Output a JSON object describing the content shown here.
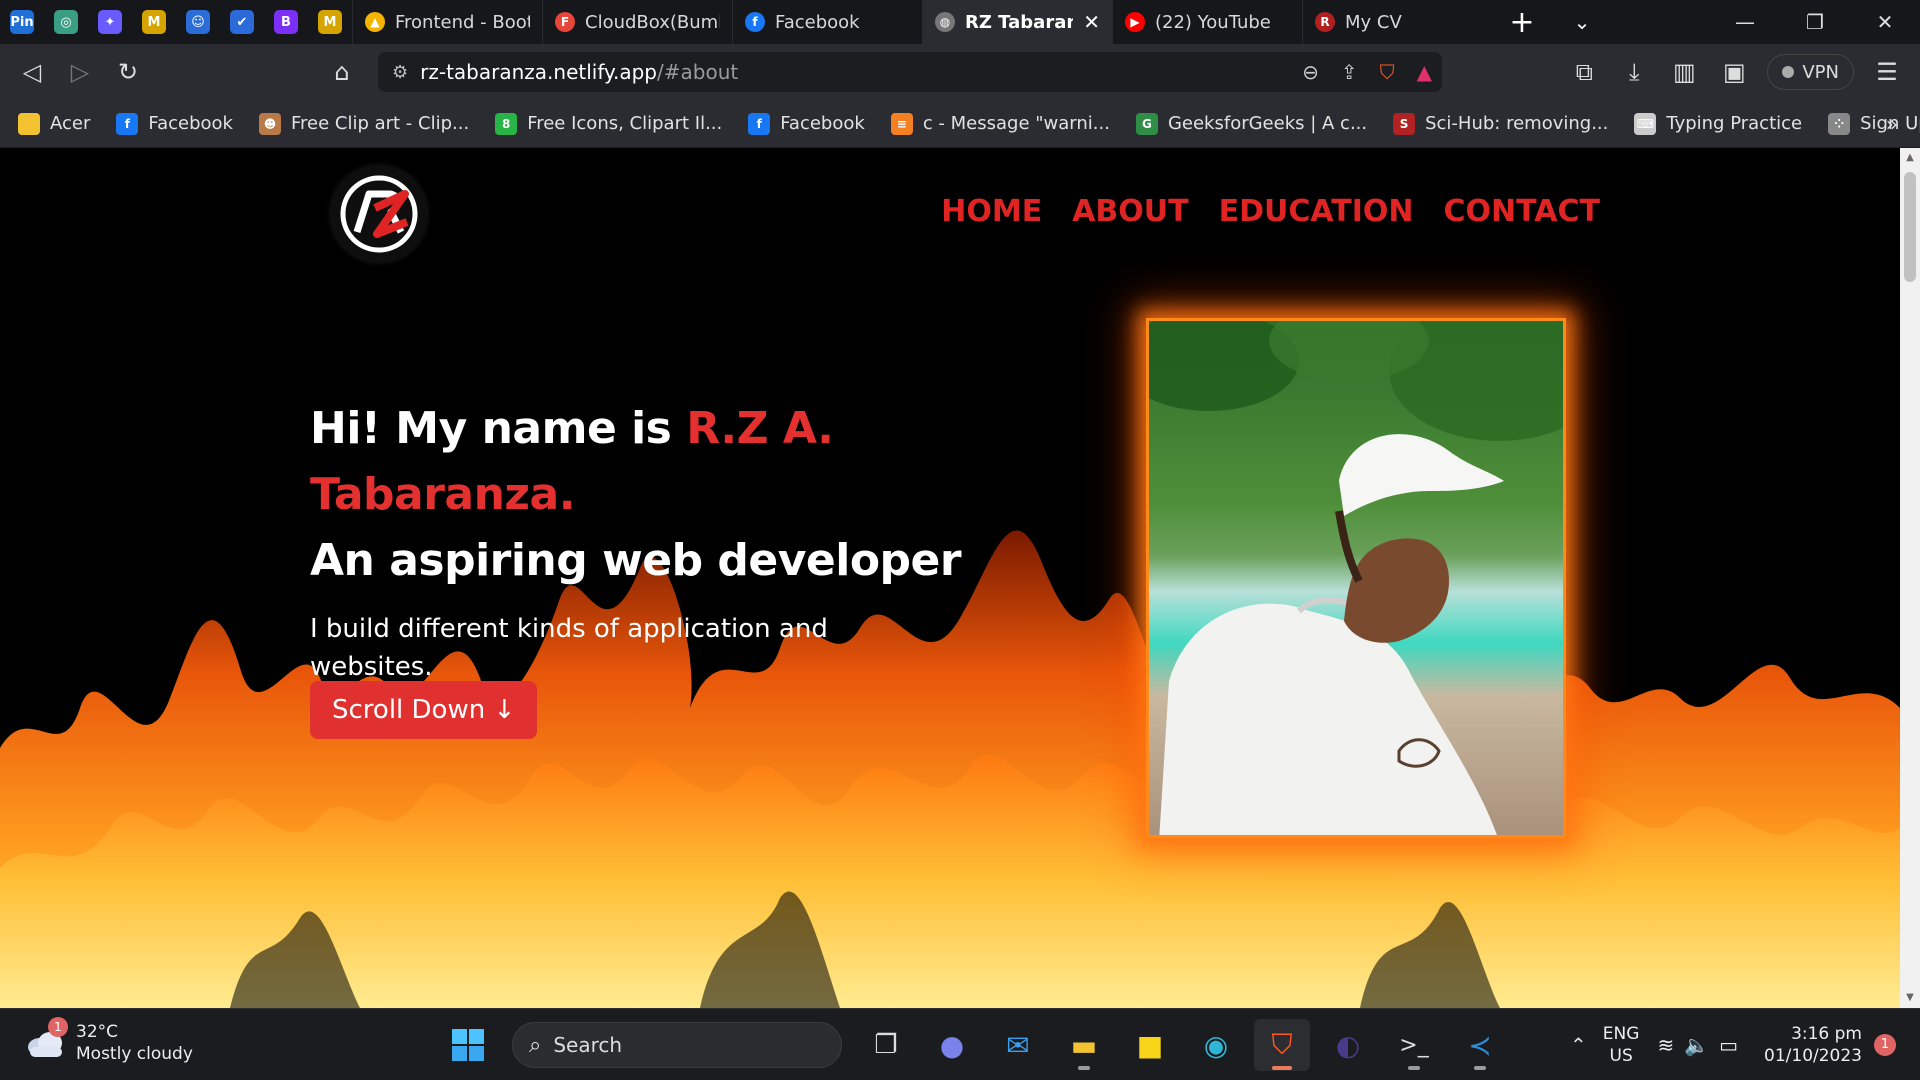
{
  "browser": {
    "pinned_tabs": [
      {
        "icon": "pinterest-icon",
        "glyph": "Pin",
        "color": "#1f6fd6"
      },
      {
        "icon": "chatgpt-icon",
        "glyph": "◎",
        "color": "#3a9e84"
      },
      {
        "icon": "sparkle-icon",
        "glyph": "✦",
        "color": "#6a5bff"
      },
      {
        "icon": "miro-icon",
        "glyph": "M",
        "color": "#d6a400"
      },
      {
        "icon": "robot-icon",
        "glyph": "☺",
        "color": "#2b6dd6"
      },
      {
        "icon": "check-icon",
        "glyph": "✔",
        "color": "#2a6bd9"
      },
      {
        "icon": "bootstrap-icon",
        "glyph": "B",
        "color": "#7b2ff7"
      },
      {
        "icon": "miro-icon",
        "glyph": "M",
        "color": "#d6a400"
      }
    ],
    "tabs": [
      {
        "title": "Frontend - Boots",
        "icon": "google-drive-icon",
        "color": "#f4b400",
        "glyph": "▲"
      },
      {
        "title": "CloudBox(Bumbu",
        "icon": "figma-icon",
        "color": "#e8463a",
        "glyph": "F"
      },
      {
        "title": "Facebook",
        "icon": "facebook-icon",
        "color": "#1877f2",
        "glyph": "f"
      },
      {
        "title": "RZ Tabaranza",
        "icon": "globe-icon",
        "color": "#777777",
        "glyph": "◍",
        "active": true
      },
      {
        "title": "(22) YouTube",
        "icon": "youtube-icon",
        "color": "#ff0000",
        "glyph": "▶"
      },
      {
        "title": "My CV",
        "icon": "rz-logo-icon",
        "color": "#b02020",
        "glyph": "R"
      }
    ],
    "address": {
      "host": "rz-tabaranza.netlify.app",
      "path": "/#about"
    },
    "vpn_label": "VPN",
    "bookmarks": [
      {
        "label": "Acer",
        "icon": "folder-icon",
        "color": "#f2c230",
        "glyph": ""
      },
      {
        "label": "Facebook",
        "icon": "facebook-icon",
        "color": "#1877f2",
        "glyph": "f"
      },
      {
        "label": "Free Clip art - Clip...",
        "icon": "clipart-icon",
        "color": "#b97a4a",
        "glyph": "☻"
      },
      {
        "label": "Free Icons, Clipart Il...",
        "icon": "icons8-icon",
        "color": "#28b446",
        "glyph": "8"
      },
      {
        "label": "Facebook",
        "icon": "facebook-icon",
        "color": "#1877f2",
        "glyph": "f"
      },
      {
        "label": "c - Message \"warni...",
        "icon": "stackoverflow-icon",
        "color": "#f48024",
        "glyph": "≡"
      },
      {
        "label": "GeeksforGeeks | A c...",
        "icon": "geeksforgeeks-icon",
        "color": "#2f8d46",
        "glyph": "G"
      },
      {
        "label": "Sci-Hub: removing...",
        "icon": "scihub-icon",
        "color": "#b22222",
        "glyph": "S"
      },
      {
        "label": "Typing Practice",
        "icon": "keyboard-icon",
        "color": "#cccccc",
        "glyph": "⌨"
      },
      {
        "label": "Sign Up",
        "icon": "dots-icon",
        "color": "#888888",
        "glyph": "⁘"
      }
    ]
  },
  "page": {
    "nav": [
      "HOME",
      "ABOUT",
      "EDUCATION",
      "CONTACT"
    ],
    "hero": {
      "greeting": "Hi! My name is ",
      "name": "R.Z A. Tabaranza.",
      "tagline": "An aspiring web developer",
      "description": "I build different kinds of application and websites.",
      "button": "Scroll Down ↓"
    },
    "accent_color": "#e02424"
  },
  "taskbar": {
    "weather": {
      "temp": "32°C",
      "condition": "Mostly cloudy",
      "badge": "1"
    },
    "search_placeholder": "Search",
    "language": [
      "ENG",
      "US"
    ],
    "time": "3:16 pm",
    "date": "01/10/2023",
    "notifications": "1"
  }
}
